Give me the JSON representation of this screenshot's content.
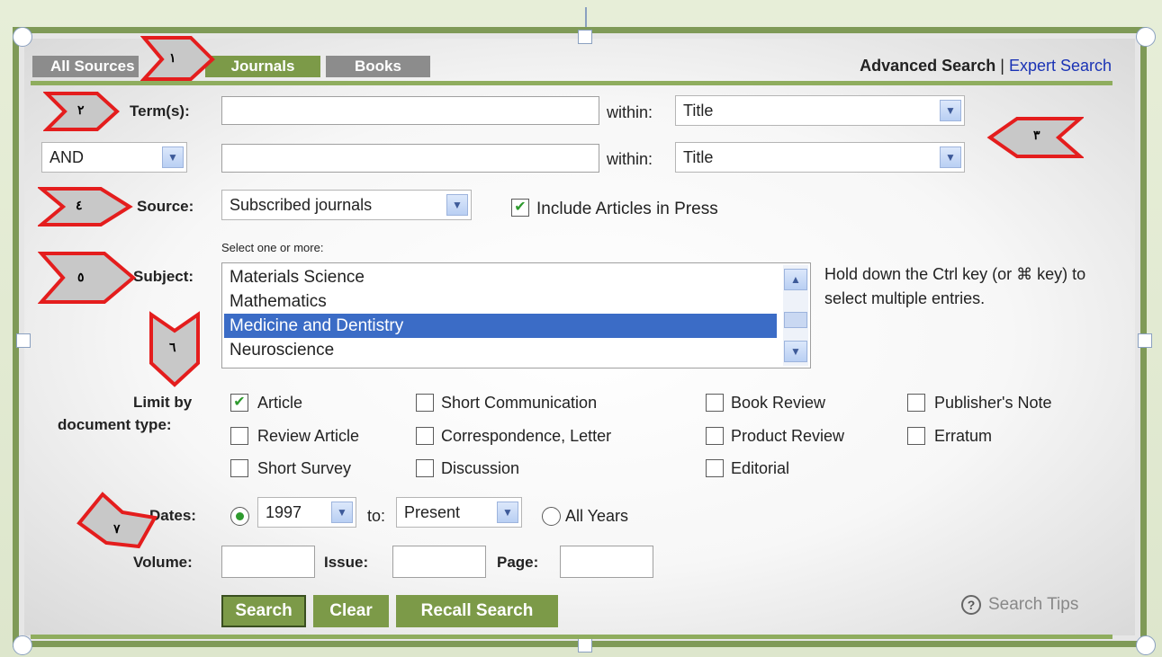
{
  "tabs": {
    "all_sources": "All Sources",
    "journals": "Journals",
    "books": "Books"
  },
  "links": {
    "advanced_search": "Advanced Search",
    "separator": "|",
    "expert_search": "Expert Search"
  },
  "terms": {
    "label": "Term(s):",
    "within_label": "within:",
    "within_value_1": "Title",
    "within_value_2": "Title",
    "operator": "AND"
  },
  "source": {
    "label": "Source:",
    "value": "Subscribed journals",
    "include_in_press": "Include Articles in Press"
  },
  "subject": {
    "label": "Subject:",
    "hint_small": "Select one or more:",
    "items": [
      "Materials Science",
      "Mathematics",
      "Medicine and Dentistry",
      "Neuroscience"
    ],
    "selected": "Medicine and Dentistry",
    "help": "Hold down the Ctrl key (or ⌘ key) to select multiple entries."
  },
  "doc_types": {
    "label_line1": "Limit by",
    "label_line2": "document type:",
    "options": [
      {
        "label": "Article",
        "checked": true
      },
      {
        "label": "Short Communication",
        "checked": false
      },
      {
        "label": "Book Review",
        "checked": false
      },
      {
        "label": "Publisher's Note",
        "checked": false
      },
      {
        "label": "Review Article",
        "checked": false
      },
      {
        "label": "Correspondence, Letter",
        "checked": false
      },
      {
        "label": "Product Review",
        "checked": false
      },
      {
        "label": "Erratum",
        "checked": false
      },
      {
        "label": "Short Survey",
        "checked": false
      },
      {
        "label": "Discussion",
        "checked": false
      },
      {
        "label": "Editorial",
        "checked": false
      }
    ]
  },
  "dates": {
    "label": "Dates:",
    "from": "1997",
    "to_label": "to:",
    "to": "Present",
    "all_years": "All Years"
  },
  "citation": {
    "volume_label": "Volume:",
    "issue_label": "Issue:",
    "page_label": "Page:"
  },
  "buttons": {
    "search": "Search",
    "clear": "Clear",
    "recall": "Recall Search",
    "tips": "Search Tips"
  },
  "markers": [
    "١",
    "٢",
    "٣",
    "٤",
    "٥",
    "٦",
    "٧"
  ],
  "colors": {
    "accent_green": "#7c9a48",
    "tab_gray": "#8c8c8c",
    "link_blue": "#1a33b5",
    "selection_blue": "#3b6cc6",
    "marker_red": "#e41d1d"
  }
}
